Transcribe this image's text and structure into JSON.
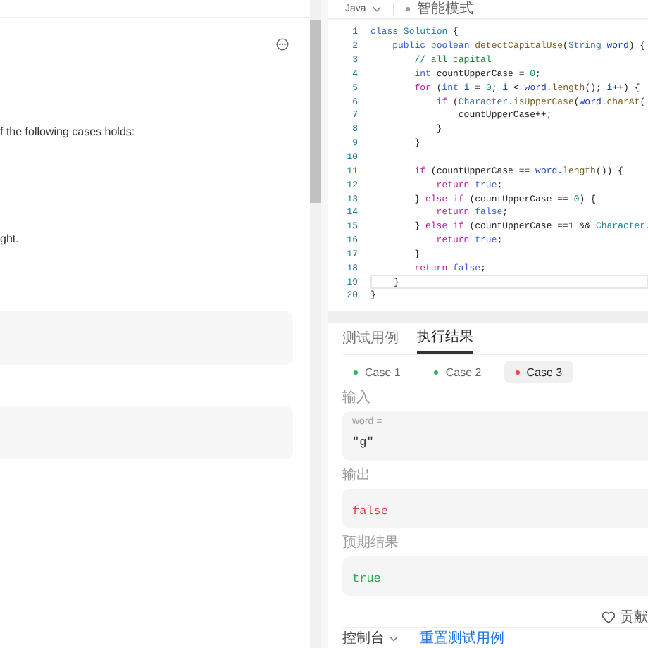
{
  "description": {
    "paragraphs": [
      "f the following cases holds:",
      "ght."
    ]
  },
  "editor": {
    "language": "Java",
    "mode": "智能模式",
    "lines": [
      {
        "number": "1",
        "current": false,
        "tokens": [
          {
            "kind": "kw",
            "text": "class"
          },
          {
            "kind": "type",
            "text": " Solution"
          },
          {
            "kind": "p",
            "text": " {"
          }
        ]
      },
      {
        "number": "2",
        "current": false,
        "tokens": [
          {
            "kind": "kw",
            "text": "    public"
          },
          {
            "kind": "kw",
            "text": " boolean"
          },
          {
            "kind": "fn",
            "text": " detectCapitalUse"
          },
          {
            "kind": "p",
            "text": "("
          },
          {
            "kind": "type",
            "text": "String"
          },
          {
            "kind": "var",
            "text": " word"
          },
          {
            "kind": "p",
            "text": ") {"
          }
        ]
      },
      {
        "number": "3",
        "current": false,
        "tokens": [
          {
            "kind": "cmt",
            "text": "        // all capital"
          }
        ]
      },
      {
        "number": "4",
        "current": false,
        "tokens": [
          {
            "kind": "kw",
            "text": "        int"
          },
          {
            "kind": "p",
            "text": " countUpperCase = "
          },
          {
            "kind": "num",
            "text": "0"
          },
          {
            "kind": "p",
            "text": ";"
          }
        ]
      },
      {
        "number": "5",
        "current": false,
        "tokens": [
          {
            "kind": "ctrl",
            "text": "        for"
          },
          {
            "kind": "p",
            "text": " ("
          },
          {
            "kind": "kw",
            "text": "int"
          },
          {
            "kind": "var",
            "text": " i"
          },
          {
            "kind": "p",
            "text": " = "
          },
          {
            "kind": "num",
            "text": "0"
          },
          {
            "kind": "p",
            "text": ";"
          },
          {
            "kind": "var",
            "text": " i"
          },
          {
            "kind": "p",
            "text": " <"
          },
          {
            "kind": "var",
            "text": " word."
          },
          {
            "kind": "fn",
            "text": "length"
          },
          {
            "kind": "p",
            "text": "();"
          },
          {
            "kind": "var",
            "text": " i"
          },
          {
            "kind": "p",
            "text": "++) {"
          }
        ]
      },
      {
        "number": "6",
        "current": false,
        "tokens": [
          {
            "kind": "ctrl",
            "text": "            if"
          },
          {
            "kind": "p",
            "text": " ("
          },
          {
            "kind": "type",
            "text": "Character."
          },
          {
            "kind": "fn",
            "text": "isUpperCase"
          },
          {
            "kind": "p",
            "text": "("
          },
          {
            "kind": "var",
            "text": "word."
          },
          {
            "kind": "fn",
            "text": "charAt"
          },
          {
            "kind": "p",
            "text": "("
          }
        ]
      },
      {
        "number": "7",
        "current": false,
        "tokens": [
          {
            "kind": "p",
            "text": "                countUpperCase++;"
          }
        ]
      },
      {
        "number": "8",
        "current": false,
        "tokens": [
          {
            "kind": "p",
            "text": "            }"
          }
        ]
      },
      {
        "number": "9",
        "current": false,
        "tokens": [
          {
            "kind": "p",
            "text": "        }"
          }
        ]
      },
      {
        "number": "10",
        "current": false
      },
      {
        "number": "11",
        "current": false,
        "tokens": [
          {
            "kind": "ctrl",
            "text": "        if"
          },
          {
            "kind": "p",
            "text": " (countUpperCase =="
          },
          {
            "kind": "var",
            "text": " word."
          },
          {
            "kind": "fn",
            "text": "length"
          },
          {
            "kind": "p",
            "text": "()) {"
          }
        ]
      },
      {
        "number": "12",
        "current": false,
        "tokens": [
          {
            "kind": "ctrl",
            "text": "            return"
          },
          {
            "kind": "kw",
            "text": " true"
          },
          {
            "kind": "p",
            "text": ";"
          }
        ]
      },
      {
        "number": "13",
        "current": false,
        "tokens": [
          {
            "kind": "p",
            "text": "        }"
          },
          {
            "kind": "ctrl",
            "text": " else if"
          },
          {
            "kind": "p",
            "text": " (countUpperCase =="
          },
          {
            "kind": "num",
            "text": " 0"
          },
          {
            "kind": "p",
            "text": ") {"
          }
        ]
      },
      {
        "number": "14",
        "current": false,
        "tokens": [
          {
            "kind": "ctrl",
            "text": "            return"
          },
          {
            "kind": "kw",
            "text": " false"
          },
          {
            "kind": "p",
            "text": ";"
          }
        ]
      },
      {
        "number": "15",
        "current": false,
        "tokens": [
          {
            "kind": "p",
            "text": "        }"
          },
          {
            "kind": "ctrl",
            "text": " else if"
          },
          {
            "kind": "p",
            "text": " (countUpperCase =="
          },
          {
            "kind": "num",
            "text": "1"
          },
          {
            "kind": "p",
            "text": " &&"
          },
          {
            "kind": "type",
            "text": " Character."
          }
        ]
      },
      {
        "number": "16",
        "current": false,
        "tokens": [
          {
            "kind": "ctrl",
            "text": "            return"
          },
          {
            "kind": "kw",
            "text": " true"
          },
          {
            "kind": "p",
            "text": ";"
          }
        ]
      },
      {
        "number": "17",
        "current": false,
        "tokens": [
          {
            "kind": "p",
            "text": "        }"
          }
        ]
      },
      {
        "number": "18",
        "current": false,
        "tokens": [
          {
            "kind": "ctrl",
            "text": "        return"
          },
          {
            "kind": "kw",
            "text": " false"
          },
          {
            "kind": "p",
            "text": ";"
          }
        ]
      },
      {
        "number": "19",
        "current": true,
        "tokens": [
          {
            "kind": "p",
            "text": "    }"
          }
        ]
      },
      {
        "number": "20",
        "current": false,
        "tokens": [
          {
            "kind": "p",
            "text": "}"
          }
        ]
      }
    ]
  },
  "results": {
    "tabs": [
      {
        "label": "测试用例",
        "selected": false
      },
      {
        "label": "执行结果",
        "selected": true
      }
    ],
    "cases": [
      {
        "label": "Case 1",
        "selected": false,
        "color": "#2db55d"
      },
      {
        "label": "Case 2",
        "selected": false,
        "color": "#2db55d"
      },
      {
        "label": "Case 3",
        "selected": true,
        "color": "#ef4743"
      }
    ],
    "input_label": "输入",
    "inputs": [
      {
        "name": "word =",
        "value": "\"g\""
      }
    ],
    "output_label": "输出",
    "output": {
      "text": "false",
      "correct": false
    },
    "expected_label": "预期结果",
    "expected": "true",
    "contribute": "贡献"
  },
  "console": {
    "label": "控制台",
    "reset": "重置测试用例"
  }
}
